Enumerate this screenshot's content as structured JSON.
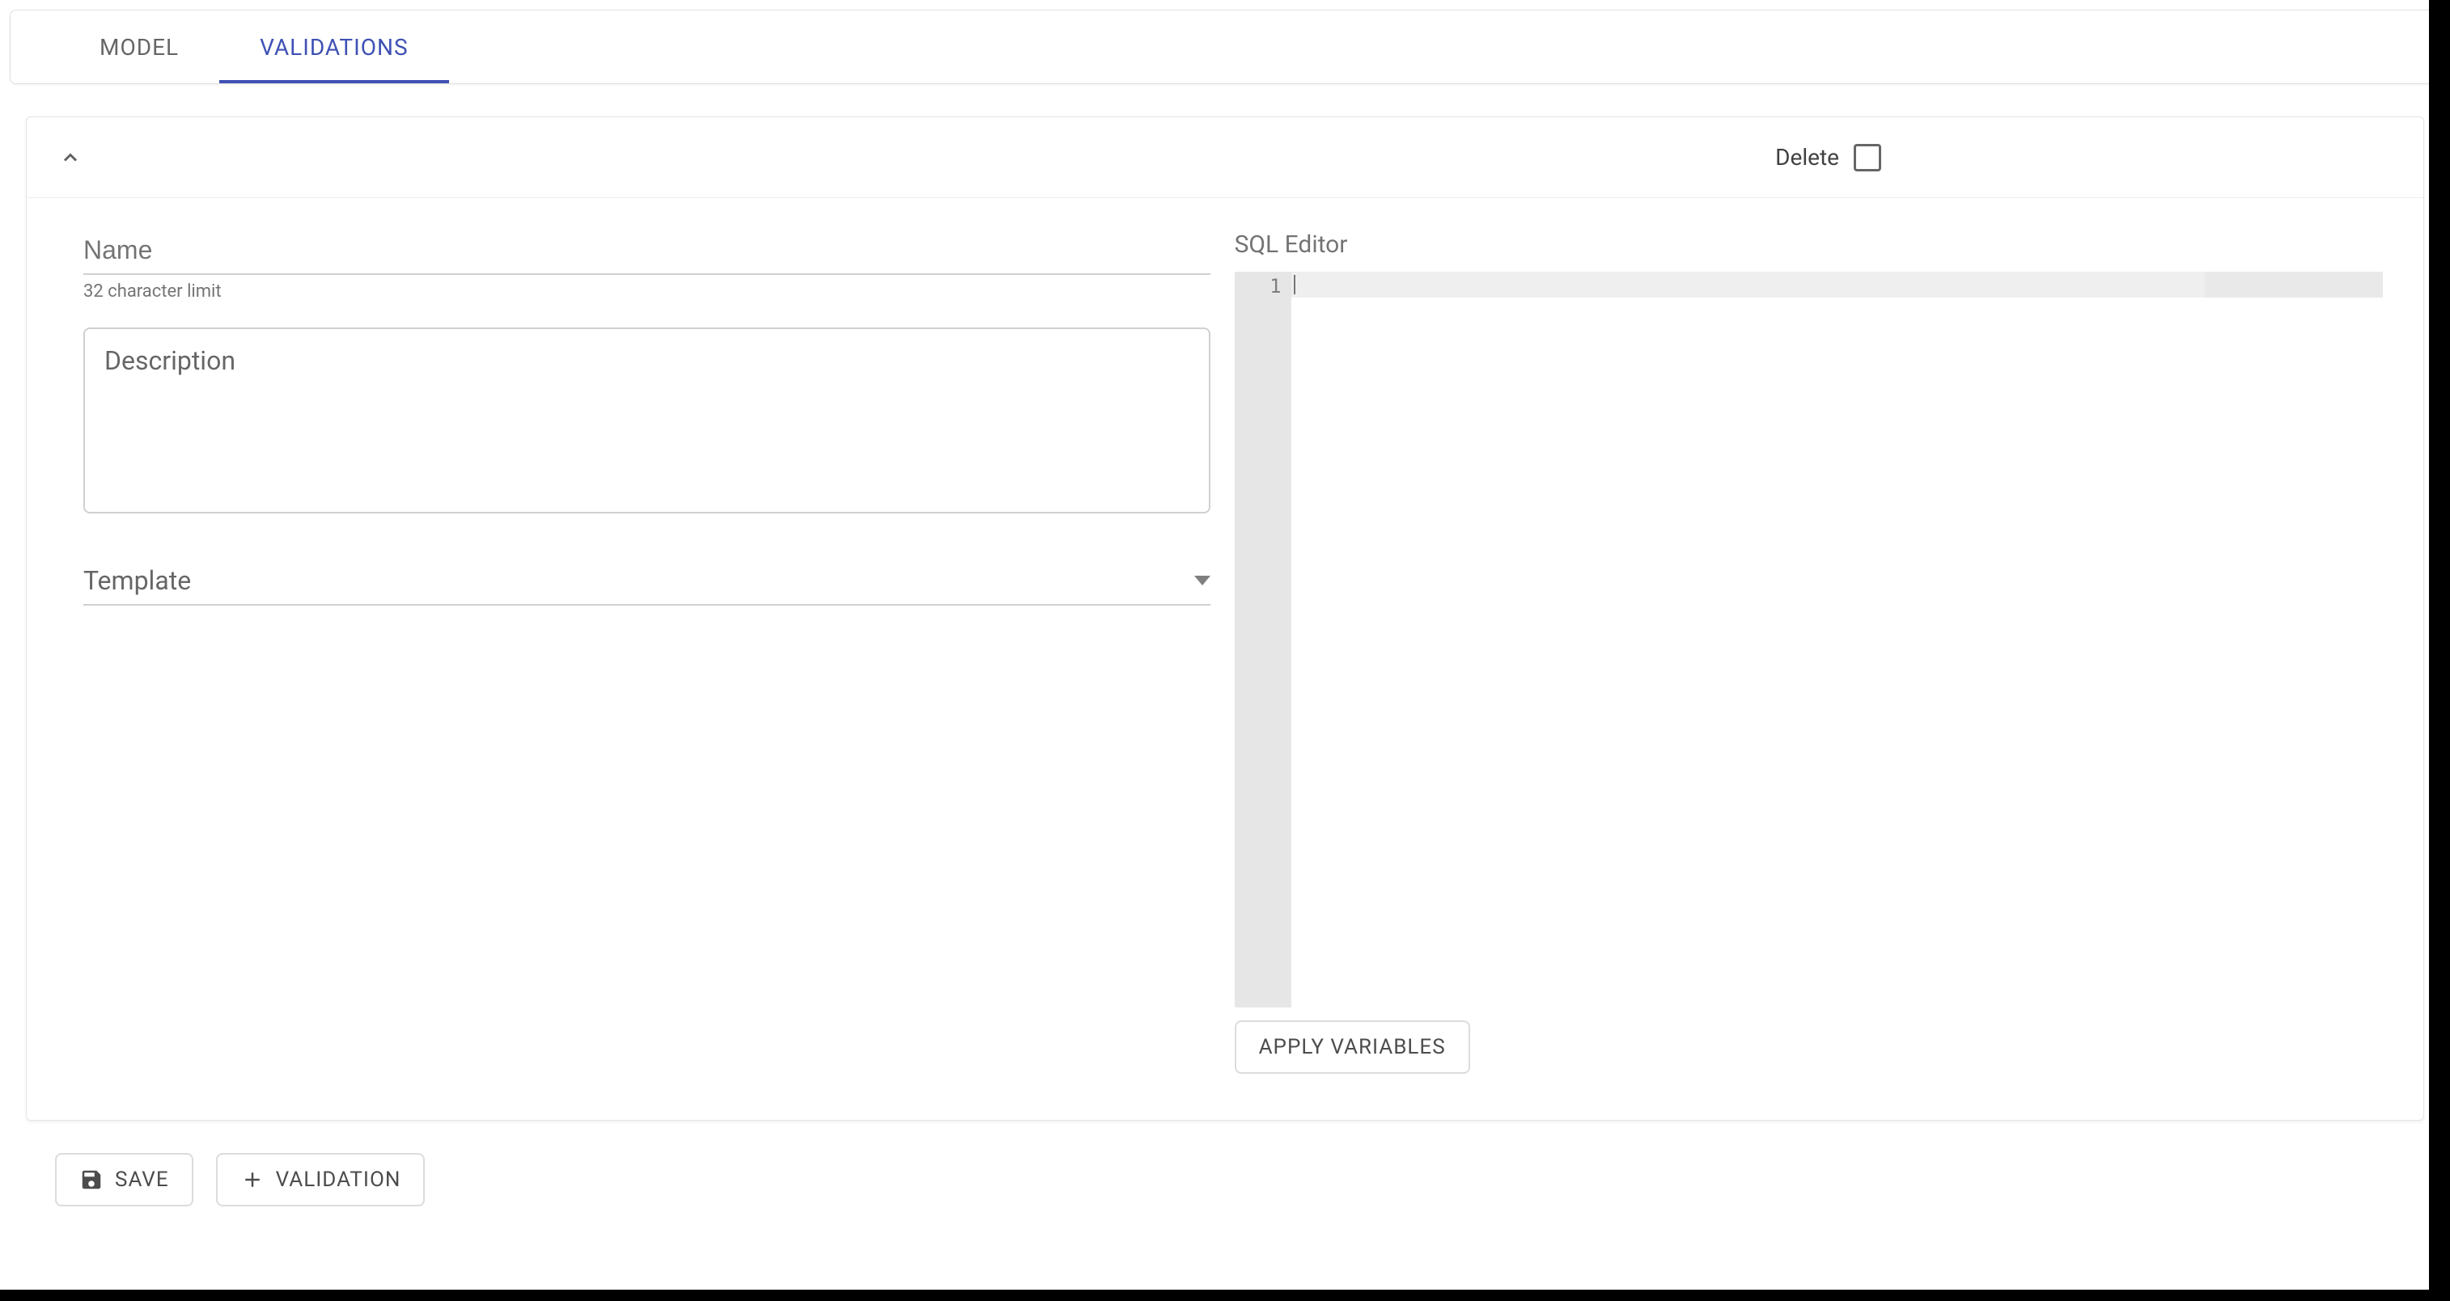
{
  "tabs": {
    "model": "MODEL",
    "validations": "VALIDATIONS",
    "active": "validations"
  },
  "card": {
    "delete_label": "Delete",
    "delete_checked": false
  },
  "form": {
    "name_placeholder": "Name",
    "name_value": "",
    "name_helper": "32 character limit",
    "description_placeholder": "Description",
    "description_value": "",
    "template_placeholder": "Template",
    "template_value": ""
  },
  "sql": {
    "label": "SQL Editor",
    "line_number": "1",
    "content": "",
    "apply_variables": "APPLY VARIABLES"
  },
  "footer": {
    "save": "SAVE",
    "add_validation": "VALIDATION"
  }
}
